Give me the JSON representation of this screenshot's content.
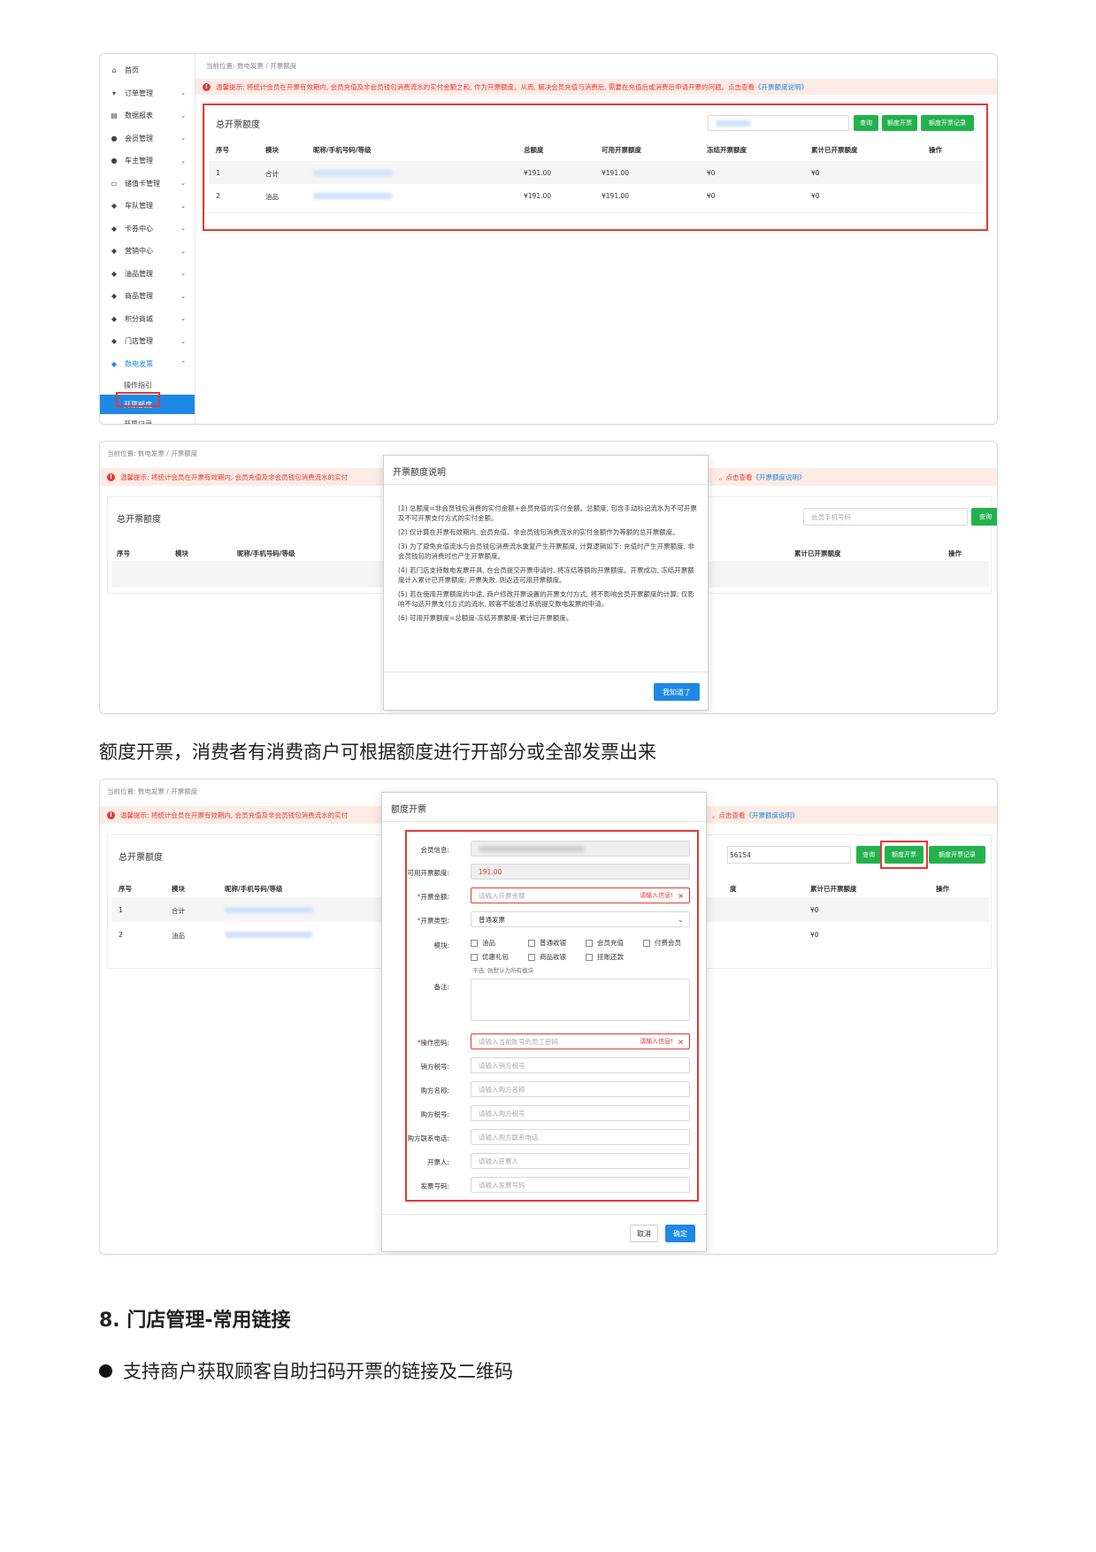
{
  "screen1": {
    "sidebar": [
      {
        "icon": "home-icon",
        "glyph": "⌂",
        "label": "首页",
        "chevron": ""
      },
      {
        "icon": "cart-icon",
        "glyph": "▾",
        "label": "订单管理",
        "chevron": "⌄"
      },
      {
        "icon": "chart-icon",
        "glyph": "▤",
        "label": "数据报表",
        "chevron": "⌄"
      },
      {
        "icon": "users-icon",
        "glyph": "●",
        "label": "会员管理",
        "chevron": "⌄"
      },
      {
        "icon": "user-icon",
        "glyph": "●",
        "label": "车主管理",
        "chevron": "⌄"
      },
      {
        "icon": "card-icon",
        "glyph": "▭",
        "label": "储值卡管理",
        "chevron": "⌄"
      },
      {
        "icon": "car-icon",
        "glyph": "◆",
        "label": "车队管理",
        "chevron": "⌄"
      },
      {
        "icon": "tag-icon",
        "glyph": "◆",
        "label": "卡券中心",
        "chevron": "⌄"
      },
      {
        "icon": "gift-icon",
        "glyph": "◆",
        "label": "营销中心",
        "chevron": "⌄"
      },
      {
        "icon": "fuel-icon",
        "glyph": "◆",
        "label": "油品管理",
        "chevron": "⌄"
      },
      {
        "icon": "goods-icon",
        "glyph": "◆",
        "label": "商品管理",
        "chevron": "⌄"
      },
      {
        "icon": "shop-icon",
        "glyph": "◆",
        "label": "积分商城",
        "chevron": "⌄"
      },
      {
        "icon": "gears-icon",
        "glyph": "◆",
        "label": "门店管理",
        "chevron": "⌄"
      },
      {
        "icon": "briefcase-icon",
        "glyph": "◆",
        "label": "数电发票",
        "chevron": "⌃"
      }
    ],
    "subitems": [
      "操作指引",
      "开票额度",
      "开票记录"
    ],
    "breadcrumb": "当前位置: 数电发票 / 开票额度",
    "tip": "温馨提示: 将统计会员在开票有效期内, 会员充值及非会员钱包消费流水的实付金额之和, 作为开票额度。从而, 解决会员充值与消费后, 需要在充值后或消费后申请开票的问题。点击查看",
    "tip_link": "《开票额度说明》",
    "card_title": "总开票额度",
    "buttons": {
      "query": "查询",
      "issue": "额度开票",
      "records": "额度开票记录"
    },
    "headers": [
      "序号",
      "模块",
      "昵称/手机号码/等级",
      "总额度",
      "可用开票额度",
      "冻结开票额度",
      "累计已开票额度",
      "操作"
    ],
    "rows": [
      [
        "1",
        "合计",
        "",
        "¥191.00",
        "¥191.00",
        "¥0",
        "¥0",
        ""
      ],
      [
        "2",
        "油品",
        "",
        "¥191.00",
        "¥191.00",
        "¥0",
        "¥0",
        ""
      ]
    ]
  },
  "screen2": {
    "breadcrumb": "当前位置: 数电发票 / 开票额度",
    "tip": "温馨提示: 将统计会员在开票有效期内, 会员充值及非会员钱包消费流水的实付",
    "tip_right": "。点击查看",
    "tip_link": "《开票额度说明》",
    "card_title": "总开票额度",
    "search_placeholder": "会员手机号码",
    "query": "查询",
    "headers_left": [
      "序号",
      "模块",
      "昵称/手机号码/等级"
    ],
    "headers_right": [
      "累计已开票额度",
      "操作"
    ],
    "modal_title": "开票额度说明",
    "paragraphs": [
      "(1) 总额度=非会员钱包消费的实付金额+会员充值的实付金额。总额度, 包含手动标记流水为不可开票及不可开票支付方式的实付金额。",
      "(2) 仅计算在开票有效期内, 会员充值、非会员钱包消费流水的实付金额作为等额的总开票额度。",
      "(3) 为了避免充值流水与会员钱包消费流水重复产生开票额度, 计算逻辑如下: 充值时产生开票额度, 非会员钱包的消费时也产生开票额度。",
      "(4) 若门店支持数电发票开具, 在会员提交开票申请时, 将冻结等额的开票额度。开票成功, 冻结开票额度计入累计已开票额度; 开票失败, 则返还可用开票额度。",
      "(5) 若在使用开票额度的中途, 商户修改开票设置的开票支付方式, 将不影响会员开票额度的计算; 仅影响不勾选开票支付方式的流水, 顾客不能通过系统提交数电发票的申请。",
      "(6) 可用开票额度=总额度-冻结开票额度-累计已开票额度。"
    ],
    "ok_button": "我知道了"
  },
  "caption": "额度开票，消费者有消费商户可根据额度进行开部分或全部发票出来",
  "screen3": {
    "breadcrumb": "当前位置: 数电发票 / 开票额度",
    "tip": "温馨提示: 将统计会员在开票有效期内, 会员充值及非会员钱包消费流水的实付",
    "tip_right": "。点击查看",
    "tip_link": "《开票额度说明》",
    "card_title": "总开票额度",
    "search_value": "56154",
    "buttons": {
      "query": "查询",
      "issue": "额度开票",
      "records": "额度开票记录"
    },
    "headers_left": [
      "序号",
      "模块",
      "昵称/手机号码/等级"
    ],
    "headers_right_a": "度",
    "headers_right": [
      "累计已开票额度",
      "操作"
    ],
    "rows": [
      {
        "no": "1",
        "module": "合计",
        "amount": "¥0"
      },
      {
        "no": "2",
        "module": "油品",
        "amount": "¥0"
      }
    ],
    "modal_title": "额度开票",
    "form": {
      "member_label": "会员信息:",
      "available_label": "可用开票额度:",
      "available_value": "191.00",
      "amount_label": "开票金额:",
      "amount_placeholder": "请输入开票金额",
      "error_text": "请输入信息!",
      "type_label": "开票类型:",
      "type_value": "普通发票",
      "module_label": "模块:",
      "modules": [
        "油品",
        "普通收银",
        "会员充值",
        "付费会员",
        "优惠礼包",
        "商品收银",
        "挂账还款"
      ],
      "module_hint": "不选, 则默认为所有模块",
      "note_label": "备注:",
      "password_label": "操作密码:",
      "password_placeholder": "请输入当前账号的员工密码",
      "seller_tax_label": "销方税号:",
      "seller_tax_placeholder": "请输入销方税号",
      "buyer_name_label": "购方名称:",
      "buyer_name_placeholder": "请输入购方名称",
      "buyer_tax_label": "购方税号:",
      "buyer_tax_placeholder": "请输入购方税号",
      "buyer_phone_label": "购方联系电话:",
      "buyer_phone_placeholder": "请输入购方联系电话",
      "drawer_label": "开票人:",
      "drawer_placeholder": "请输入开票人",
      "invoice_no_label": "发票号码:",
      "invoice_no_placeholder": "请输入发票号码"
    },
    "cancel": "取消",
    "confirm": "确定"
  },
  "section_heading": "8. 门店管理-常用链接",
  "bullet": "支持商户获取顾客自助扫码开票的链接及二维码"
}
